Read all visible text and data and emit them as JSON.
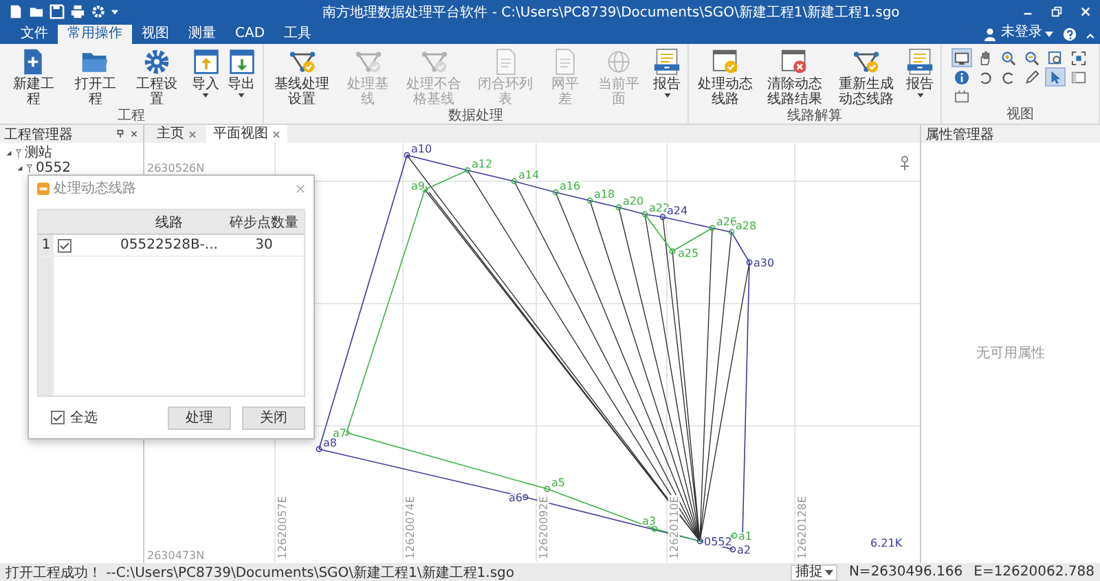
{
  "window": {
    "title": "南方地理数据处理平台软件 - C:\\Users\\PC8739\\Documents\\SGO\\新建工程1\\新建工程1.sgo"
  },
  "menu_tabs": [
    {
      "label": "文件",
      "selected": false
    },
    {
      "label": "常用操作",
      "selected": true
    },
    {
      "label": "视图",
      "selected": false
    },
    {
      "label": "测量",
      "selected": false
    },
    {
      "label": "CAD",
      "selected": false
    },
    {
      "label": "工具",
      "selected": false
    }
  ],
  "account": {
    "label": "未登录"
  },
  "ribbon": {
    "groups": [
      {
        "kind": "buttons",
        "label": "工程",
        "items": [
          {
            "label": "新建工程",
            "disabled": false,
            "dropdown": false
          },
          {
            "label": "打开工程",
            "disabled": false,
            "dropdown": false
          },
          {
            "label": "工程设置",
            "disabled": false,
            "dropdown": false
          },
          {
            "label": "导入",
            "disabled": false,
            "dropdown": true
          },
          {
            "label": "导出",
            "disabled": false,
            "dropdown": true
          }
        ]
      },
      {
        "kind": "buttons",
        "label": "数据处理",
        "items": [
          {
            "label": "基线处理设置",
            "disabled": false,
            "dropdown": false
          },
          {
            "label": "处理基线",
            "disabled": true,
            "dropdown": false
          },
          {
            "label": "处理不合格基线",
            "disabled": true,
            "dropdown": false
          },
          {
            "label": "闭合环列表",
            "disabled": true,
            "dropdown": false
          },
          {
            "label": "网平差",
            "disabled": true,
            "dropdown": false
          },
          {
            "label": "当前平面",
            "disabled": true,
            "dropdown": false
          },
          {
            "label": "报告",
            "disabled": false,
            "dropdown": true
          }
        ]
      },
      {
        "kind": "buttons",
        "label": "线路解算",
        "items": [
          {
            "label": "处理动态线路",
            "disabled": false,
            "dropdown": false
          },
          {
            "label": "清除动态线路结果",
            "disabled": false,
            "dropdown": false
          },
          {
            "label": "重新生成动态线路",
            "disabled": false,
            "dropdown": false
          },
          {
            "label": "报告",
            "disabled": false,
            "dropdown": true
          }
        ]
      },
      {
        "kind": "tools",
        "label": "视图",
        "tools": [
          {
            "selected": true
          },
          {
            "selected": false
          },
          {
            "selected": false
          },
          {
            "selected": false
          },
          {
            "selected": false
          },
          {
            "selected": false
          },
          {
            "selected": false
          },
          {
            "selected": false
          },
          {
            "selected": false
          },
          {
            "selected": false
          },
          {
            "selected": true
          },
          {
            "selected": false
          },
          {
            "selected": false
          }
        ]
      }
    ]
  },
  "project_panel": {
    "title": "工程管理器",
    "tree": [
      {
        "label": "测站",
        "expanded": true,
        "children": [
          {
            "label": "0552",
            "expanded": true
          }
        ]
      }
    ]
  },
  "doc_tabs": [
    {
      "label": "主页",
      "selected": false
    },
    {
      "label": "平面视图",
      "selected": true
    }
  ],
  "map": {
    "north_labels": [
      "2630526N",
      "2630473N"
    ],
    "east_labels": [
      "12620057E",
      "12620074E",
      "12620092E",
      "12620110E",
      "12620128E"
    ],
    "points": [
      {
        "label": "a10",
        "color": "#3b3b9c"
      },
      {
        "label": "a12",
        "color": "#3cb043"
      },
      {
        "label": "a9",
        "color": "#3cb043"
      },
      {
        "label": "a14",
        "color": "#3cb043"
      },
      {
        "label": "a16",
        "color": "#3cb043"
      },
      {
        "label": "a18",
        "color": "#3cb043"
      },
      {
        "label": "a20",
        "color": "#3cb043"
      },
      {
        "label": "a22",
        "color": "#3cb043"
      },
      {
        "label": "a24",
        "color": "#3b3b9c"
      },
      {
        "label": "a26",
        "color": "#3cb043"
      },
      {
        "label": "a28",
        "color": "#3cb043"
      },
      {
        "label": "a25",
        "color": "#3cb043"
      },
      {
        "label": "a30",
        "color": "#3b3b9c"
      },
      {
        "label": "a7",
        "color": "#3cb043"
      },
      {
        "label": "a8",
        "color": "#3b3b9c"
      },
      {
        "label": "a6",
        "color": "#3b3b9c"
      },
      {
        "label": "a5",
        "color": "#3cb043"
      },
      {
        "label": "a3",
        "color": "#3cb043"
      },
      {
        "label": "0552",
        "color": "#3b3b9c"
      },
      {
        "label": "a1",
        "color": "#3cb043"
      },
      {
        "label": "a2",
        "color": "#3b3b9c"
      }
    ],
    "scale": "6.21K"
  },
  "dialog": {
    "title": "处理动态线路",
    "columns": [
      "线路",
      "碎步点数量"
    ],
    "rows": [
      {
        "index": "1",
        "checked": true,
        "route": "05522528B-...",
        "count": "30"
      }
    ],
    "select_all": {
      "label": "全选",
      "checked": true
    },
    "buttons": [
      "处理",
      "关闭"
    ]
  },
  "property_panel": {
    "title": "属性管理器",
    "empty_text": "无可用属性"
  },
  "status_bar": {
    "message": "打开工程成功！ --C:\\Users\\PC8739\\Documents\\SGO\\新建工程1\\新建工程1.sgo",
    "snap": "捕捉",
    "north": "N=2630496.166",
    "east": "E=12620062.788"
  }
}
